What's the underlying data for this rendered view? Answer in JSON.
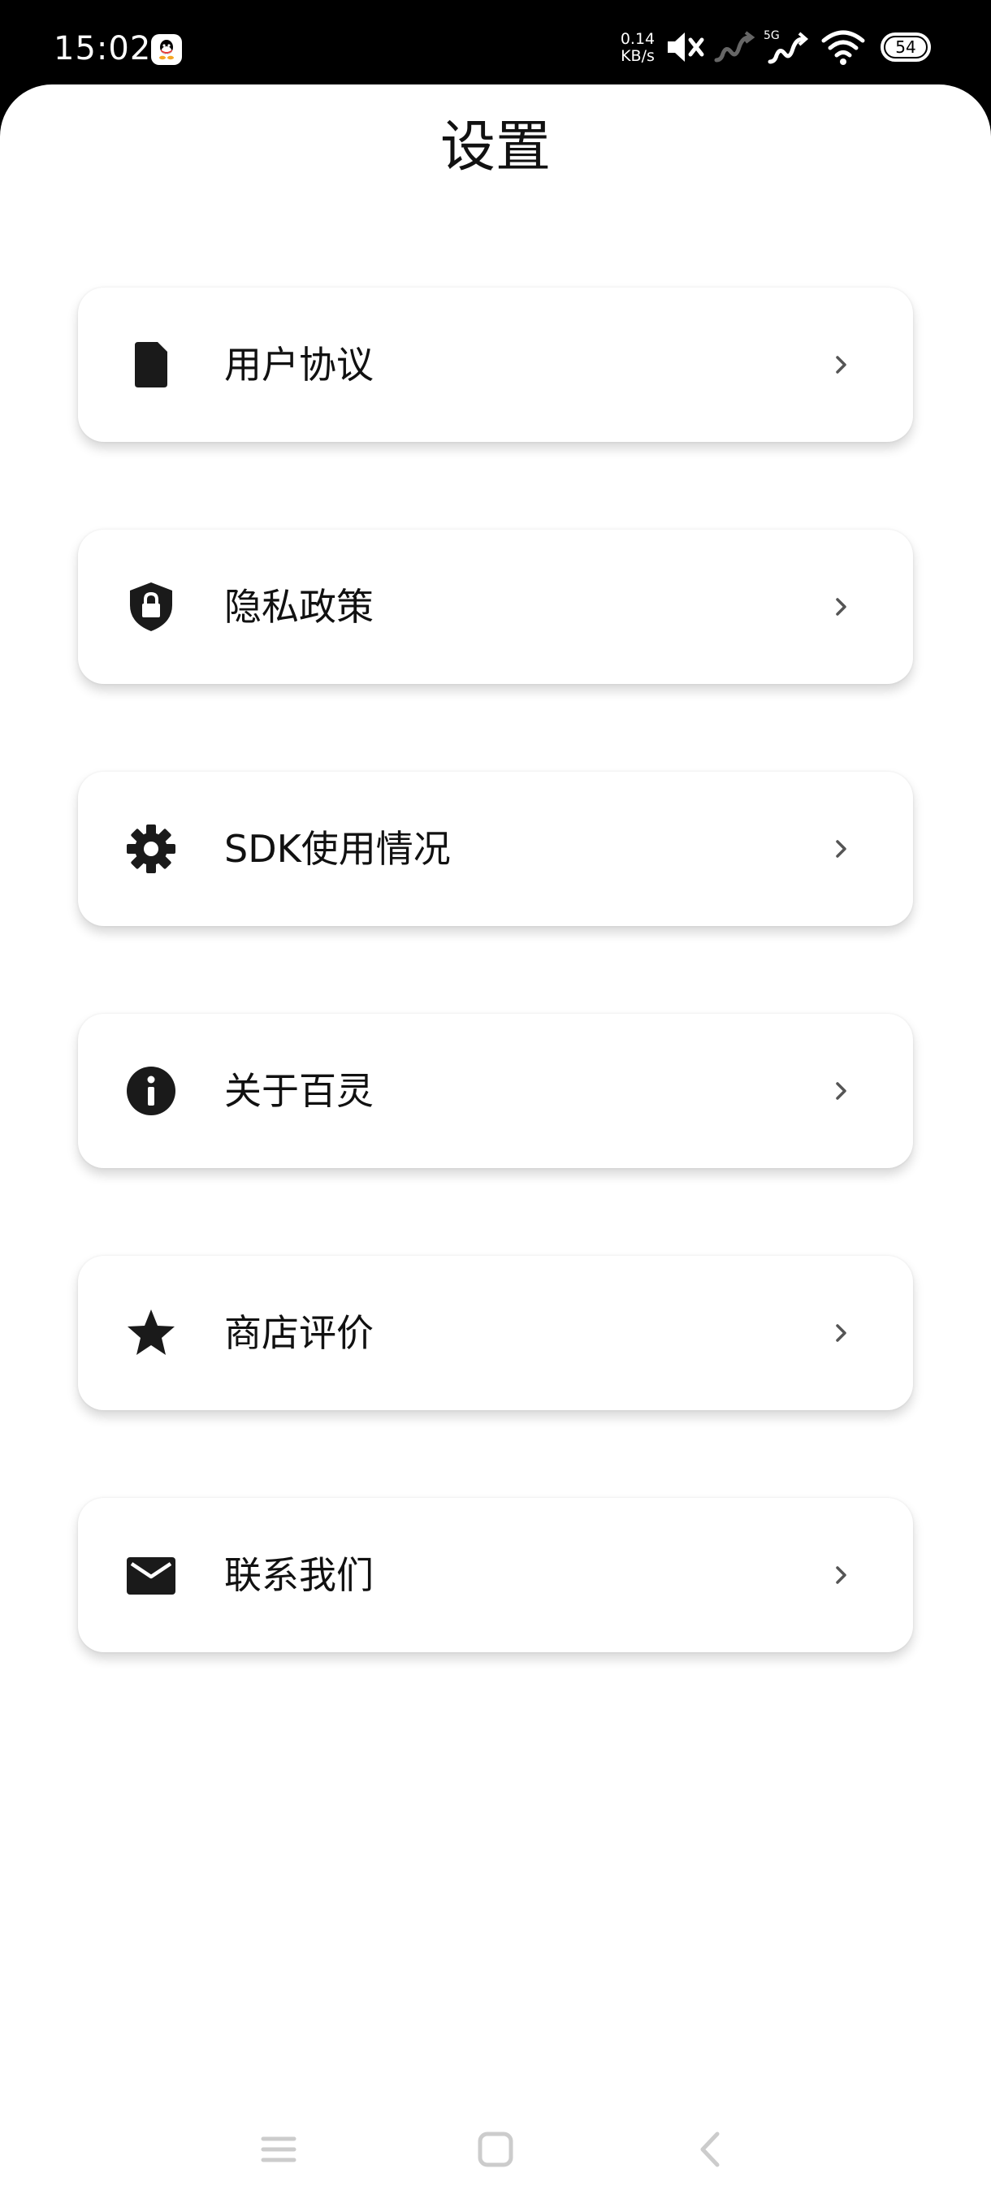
{
  "status_bar": {
    "time": "15:02",
    "net_speed_value": "0.14",
    "net_speed_unit": "KB/s",
    "network_type": "5G",
    "battery": "54",
    "icons": [
      "qq-icon",
      "mute-icon",
      "signal-inactive-icon",
      "signal-5g-icon",
      "wifi-icon",
      "battery-icon"
    ]
  },
  "header": {
    "title": "设置"
  },
  "menu": {
    "items": [
      {
        "label": "用户协议",
        "icon": "document-icon"
      },
      {
        "label": "隐私政策",
        "icon": "shield-lock-icon"
      },
      {
        "label": "SDK使用情况",
        "icon": "gear-icon"
      },
      {
        "label": "关于百灵",
        "icon": "info-icon"
      },
      {
        "label": "商店评价",
        "icon": "star-icon"
      },
      {
        "label": "联系我们",
        "icon": "mail-icon"
      }
    ],
    "chevron_icon": "chevron-right-icon"
  },
  "nav_bar": {
    "buttons": [
      "menu-nav-icon",
      "home-nav-icon",
      "back-nav-icon"
    ]
  },
  "colors": {
    "status_bar_bg": "#000000",
    "page_bg": "#ffffff",
    "text": "#111111",
    "chevron": "#555555",
    "nav_icons": "#cccccc"
  }
}
